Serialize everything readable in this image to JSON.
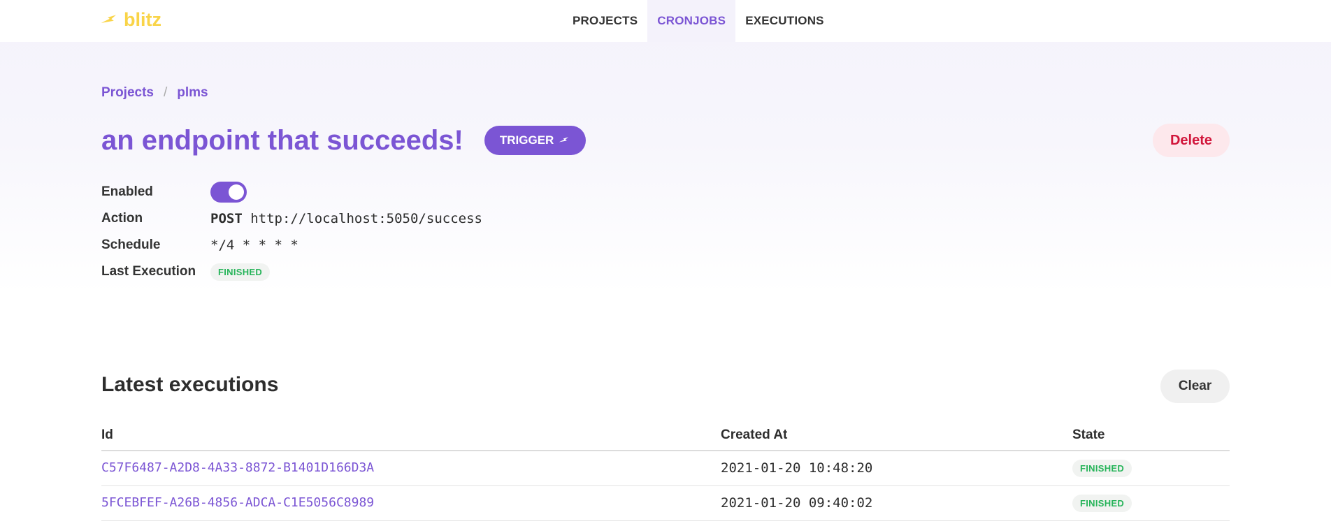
{
  "header": {
    "logo_text": "blitz",
    "nav": [
      {
        "label": "PROJECTS"
      },
      {
        "label": "CRONJOBS"
      },
      {
        "label": "EXECUTIONS"
      }
    ]
  },
  "breadcrumb": {
    "items": [
      "Projects",
      "plms"
    ],
    "separator": "/"
  },
  "cronjob": {
    "title": "an endpoint that succeeds!",
    "trigger_label": "TRIGGER",
    "delete_label": "Delete",
    "enabled_label": "Enabled",
    "enabled": true,
    "action_label": "Action",
    "action_method": "POST",
    "action_url": "http://localhost:5050/success",
    "schedule_label": "Schedule",
    "schedule": "*/4 * * * *",
    "last_execution_label": "Last Execution",
    "last_execution_state": "FINISHED"
  },
  "executions": {
    "title": "Latest executions",
    "clear_label": "Clear",
    "columns": [
      "Id",
      "Created At",
      "State"
    ],
    "rows": [
      {
        "id": "C57F6487-A2D8-4A33-8872-B1401D166D3A",
        "created_at": "2021-01-20 10:48:20",
        "state": "FINISHED"
      },
      {
        "id": "5FCEBFEF-A26B-4856-ADCA-C1E5056C8989",
        "created_at": "2021-01-20 09:40:02",
        "state": "FINISHED"
      }
    ]
  },
  "colors": {
    "accent": "#7b55d4",
    "logo": "#f9d448",
    "danger": "#d1163b",
    "success": "#27b45a"
  },
  "icons": {
    "logo": "lightning-bolt-icon",
    "trigger": "lightning-bolt-icon"
  }
}
